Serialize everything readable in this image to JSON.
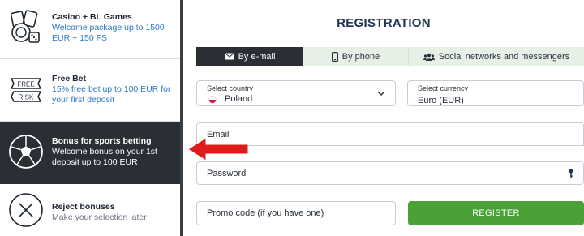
{
  "bonuses": [
    {
      "title": "Casino + BL Games",
      "desc": "Welcome package up to 1500 EUR + 150 FS",
      "icon": "casino-chips-icon"
    },
    {
      "title": "Free Bet",
      "desc": "15% free bet up to 100 EUR for your first deposit",
      "icon": "free-risk-ticket-icon",
      "ticket_top": "FREE",
      "ticket_bottom": "RISK"
    },
    {
      "title": "Bonus for sports betting",
      "desc": "Welcome bonus on your 1st deposit up to 100 EUR",
      "icon": "soccer-ball-icon",
      "active": true
    },
    {
      "title": "Reject bonuses",
      "desc": "Make your selection later",
      "icon": "close-icon"
    }
  ],
  "registration": {
    "title": "REGISTRATION",
    "tabs": [
      "By e-mail",
      "By phone",
      "Social networks and messengers"
    ],
    "country_label": "Select country",
    "country_value": "Poland",
    "currency_label": "Select currency",
    "currency_value": "Euro (EUR)",
    "email_placeholder": "Email",
    "password_placeholder": "Password",
    "promo_placeholder": "Promo code (if you have one)",
    "register_label": "REGISTER"
  },
  "colors": {
    "accent_green": "#4aa237",
    "dark": "#2a2f36",
    "link_blue": "#2f78c4",
    "arrow_red": "#e01b1b"
  }
}
